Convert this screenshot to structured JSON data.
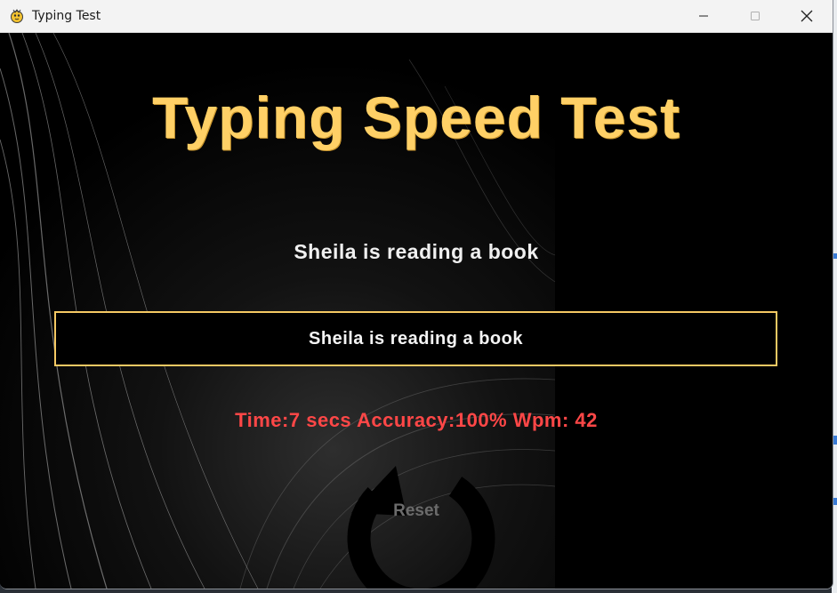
{
  "window": {
    "title": "Typing Test",
    "controls": [
      "minimize",
      "maximize",
      "close"
    ]
  },
  "app": {
    "heading": "Typing Speed Test",
    "sentence": "Sheila is reading a book",
    "input_value": "Sheila is reading a book",
    "results": "Time:7 secs Accuracy:100% Wpm: 42",
    "reset_label": "Reset"
  },
  "icons": {
    "app": "pygame-snake-icon",
    "reset": "circular-arrow-icon"
  },
  "colors": {
    "heading": "#ffd066",
    "input_border": "#f5c963",
    "results": "#ff4747",
    "background": "#000000",
    "reset_label": "#6b6b6b"
  }
}
